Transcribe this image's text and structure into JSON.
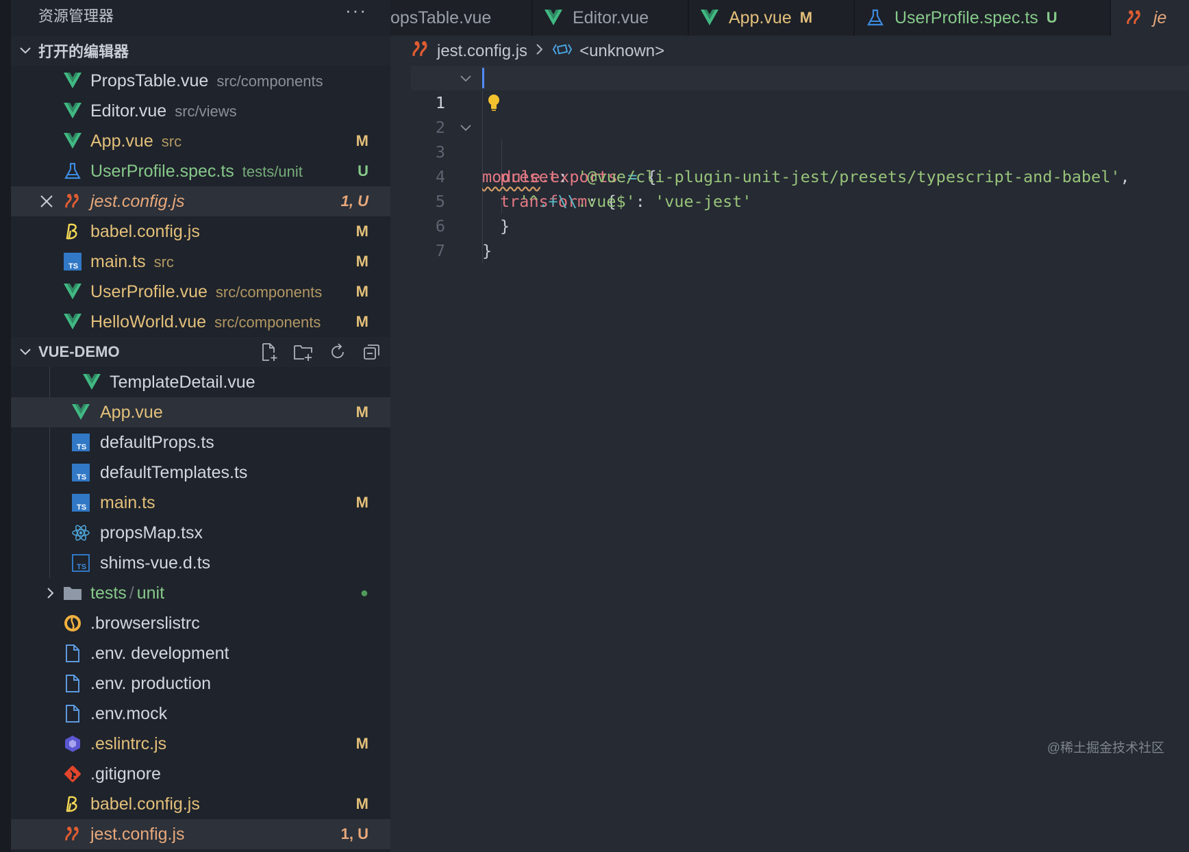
{
  "sidebar": {
    "title": "资源管理器",
    "more": "···",
    "open_editors": {
      "title": "打开的编辑器",
      "items": [
        {
          "name": "PropsTable.vue",
          "path": "src/components",
          "badge": ""
        },
        {
          "name": "Editor.vue",
          "path": "src/views",
          "badge": ""
        },
        {
          "name": "App.vue",
          "path": "src",
          "badge": "M"
        },
        {
          "name": "UserProfile.spec.ts",
          "path": "tests/unit",
          "badge": "U"
        },
        {
          "name": "jest.config.js",
          "path": "",
          "badge": "1, U"
        },
        {
          "name": "babel.config.js",
          "path": "",
          "badge": "M"
        },
        {
          "name": "main.ts",
          "path": "src",
          "badge": "M"
        },
        {
          "name": "UserProfile.vue",
          "path": "src/components",
          "badge": "M"
        },
        {
          "name": "HelloWorld.vue",
          "path": "src/components",
          "badge": "M"
        }
      ]
    },
    "project": {
      "title": "VUE-DEMO",
      "items": [
        {
          "name": "TemplateDetail.vue",
          "badge": ""
        },
        {
          "name": "App.vue",
          "badge": "M"
        },
        {
          "name": "defaultProps.ts",
          "badge": ""
        },
        {
          "name": "defaultTemplates.ts",
          "badge": ""
        },
        {
          "name": "main.ts",
          "badge": "M"
        },
        {
          "name": "propsMap.tsx",
          "badge": ""
        },
        {
          "name": "shims-vue.d.ts",
          "badge": ""
        },
        {
          "name": "tests",
          "sep": "/",
          "sub": "unit",
          "badge": "●"
        },
        {
          "name": ".browserslistrc",
          "badge": ""
        },
        {
          "name": ".env. development",
          "badge": ""
        },
        {
          "name": ".env. production",
          "badge": ""
        },
        {
          "name": ".env.mock",
          "badge": ""
        },
        {
          "name": ".eslintrc.js",
          "badge": "M"
        },
        {
          "name": ".gitignore",
          "badge": ""
        },
        {
          "name": "babel.config.js",
          "badge": "M"
        },
        {
          "name": "jest.config.js",
          "badge": "1, U"
        }
      ]
    }
  },
  "tabs": [
    {
      "name": "opsTable.vue",
      "badge": ""
    },
    {
      "name": "Editor.vue",
      "badge": ""
    },
    {
      "name": "App.vue",
      "badge": "M"
    },
    {
      "name": "UserProfile.spec.ts",
      "badge": "U"
    },
    {
      "name": "je",
      "badge": ""
    }
  ],
  "breadcrumb": {
    "file": "jest.config.js",
    "symbol": "<unknown>"
  },
  "editor": {
    "line_numbers": [
      "1",
      "2",
      "3",
      "4",
      "5",
      "6",
      "7"
    ],
    "code": {
      "l1_module": "module",
      "l1_rest": ".exports",
      "l1_eq": " = ",
      "l1_brace": "{",
      "l2_key": "preset",
      "l2_colon": ": ",
      "l2_val": "'@vue/cli-plugin-unit-jest/presets/typescript-and-babel'",
      "l2_comma": ",",
      "l3_key": "transform",
      "l3_colon": ": ",
      "l3_brace": "{",
      "l4_q1": "'^",
      "l4_mid": ".+",
      "l4_esc": "\\\\",
      "l4_end": ".vue$'",
      "l4_colon": ": ",
      "l4_val": "'vue-jest'",
      "l5_brace": "}",
      "l6_brace": "}"
    }
  },
  "watermark": "@稀土掘金技术社区",
  "colors": {
    "vue": "#41b883",
    "ts": "#3178c6",
    "jest": "#e05d32",
    "babel": "#f5da55",
    "modified": "#e3c07a",
    "untracked": "#86c98a"
  }
}
